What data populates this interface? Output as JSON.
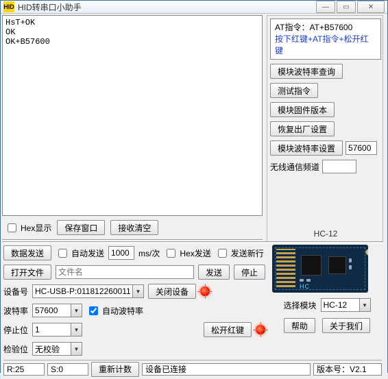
{
  "window": {
    "icon_text": "HID",
    "title": "HID转串口小助手"
  },
  "rx": {
    "text": "HsT+OK\nOK\nOK+B57600",
    "hex_label": "Hex显示",
    "save_btn": "保存窗口",
    "clear_btn": "接收清空"
  },
  "at_panel": {
    "line1": "AT指令：AT+B57600",
    "line2": "按下红键+AT指令+松开红键",
    "btn_query_baud": "模块波特率查询",
    "btn_test": "测试指令",
    "btn_fw": "模块固件版本",
    "btn_factory": "恢复出厂设置",
    "btn_set_baud": "模块波特率设置",
    "baud_value": "57600",
    "lbl_channel": "无线通信频道",
    "channel_value": "",
    "hc_label": "HC-12"
  },
  "tx": {
    "send_btn": "数据发送",
    "auto_send_label": "自动发送",
    "auto_send_value": "1000",
    "auto_send_unit": "ms/次",
    "hex_send_label": "Hex发送",
    "newline_label": "发送新行",
    "open_file_btn": "打开文件",
    "filename_placeholder": "文件名",
    "filename_value": "",
    "send2_btn": "发送",
    "stop_btn": "停止",
    "device_lbl": "设备号",
    "device_value": "HC-USB-P:011812260011",
    "close_device_btn": "关闭设备",
    "baud_lbl": "波特率",
    "baud_value": "57600",
    "auto_baud_label": "自动波特率",
    "stop_lbl": "停止位",
    "stop_value": "1",
    "parity_lbl": "检验位",
    "parity_value": "无校验",
    "red_btn": "松开红键",
    "select_module_lbl": "选择模块",
    "select_module_value": "HC-12",
    "help_btn": "帮助",
    "about_btn": "关于我们"
  },
  "status": {
    "r_label": "R:",
    "r_value": "25",
    "s_label": "S:",
    "s_value": "0",
    "reset_btn": "重新计数",
    "conn_text": "设备已连接",
    "version": "版本号：V2.1"
  }
}
